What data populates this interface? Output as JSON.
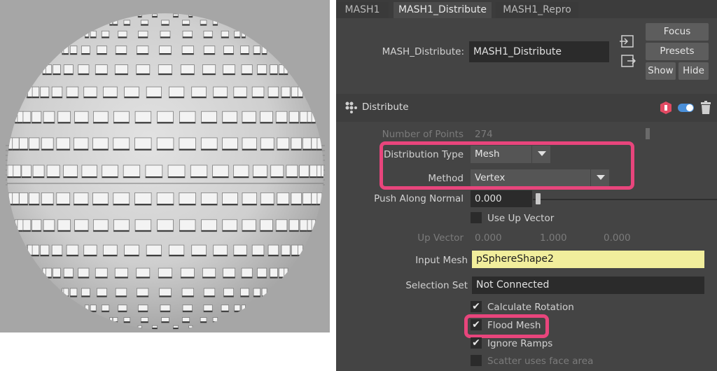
{
  "tabs": [
    "MASH1",
    "MASH1_Distribute",
    "MASH1_Repro"
  ],
  "node": {
    "label": "MASH_Distribute:",
    "value": "MASH1_Distribute"
  },
  "buttons": {
    "focus": "Focus",
    "presets": "Presets",
    "show": "Show",
    "hide": "Hide"
  },
  "section": {
    "title": "Distribute"
  },
  "fields": {
    "number_of_points_label": "Number of Points",
    "number_of_points_value": "274",
    "distribution_type_label": "Distribution Type",
    "distribution_type_value": "Mesh",
    "method_label": "Method",
    "method_value": "Vertex",
    "push_label": "Push Along Normal",
    "push_value": "0.000",
    "use_up_vector_label": "Use Up Vector",
    "up_vector_label": "Up Vector",
    "up_vector_x": "0.000",
    "up_vector_y": "1.000",
    "up_vector_z": "0.000",
    "input_mesh_label": "Input Mesh",
    "input_mesh_value": "pSphereShape2",
    "selection_set_label": "Selection Set",
    "selection_set_value": "Not Connected"
  },
  "checkboxes": {
    "calculate_rotation": {
      "label": "Calculate Rotation",
      "checked": true
    },
    "flood_mesh": {
      "label": "Flood Mesh",
      "checked": true
    },
    "ignore_ramps": {
      "label": "Ignore Ramps",
      "checked": true
    },
    "scatter_face_area": {
      "label": "Scatter uses face area",
      "checked": false
    }
  },
  "colors": {
    "highlight": "#e8457c",
    "input_mesh_bg": "#f1ee9c",
    "viewport_bg": "#a6a6a6",
    "panel_bg": "#444444"
  }
}
